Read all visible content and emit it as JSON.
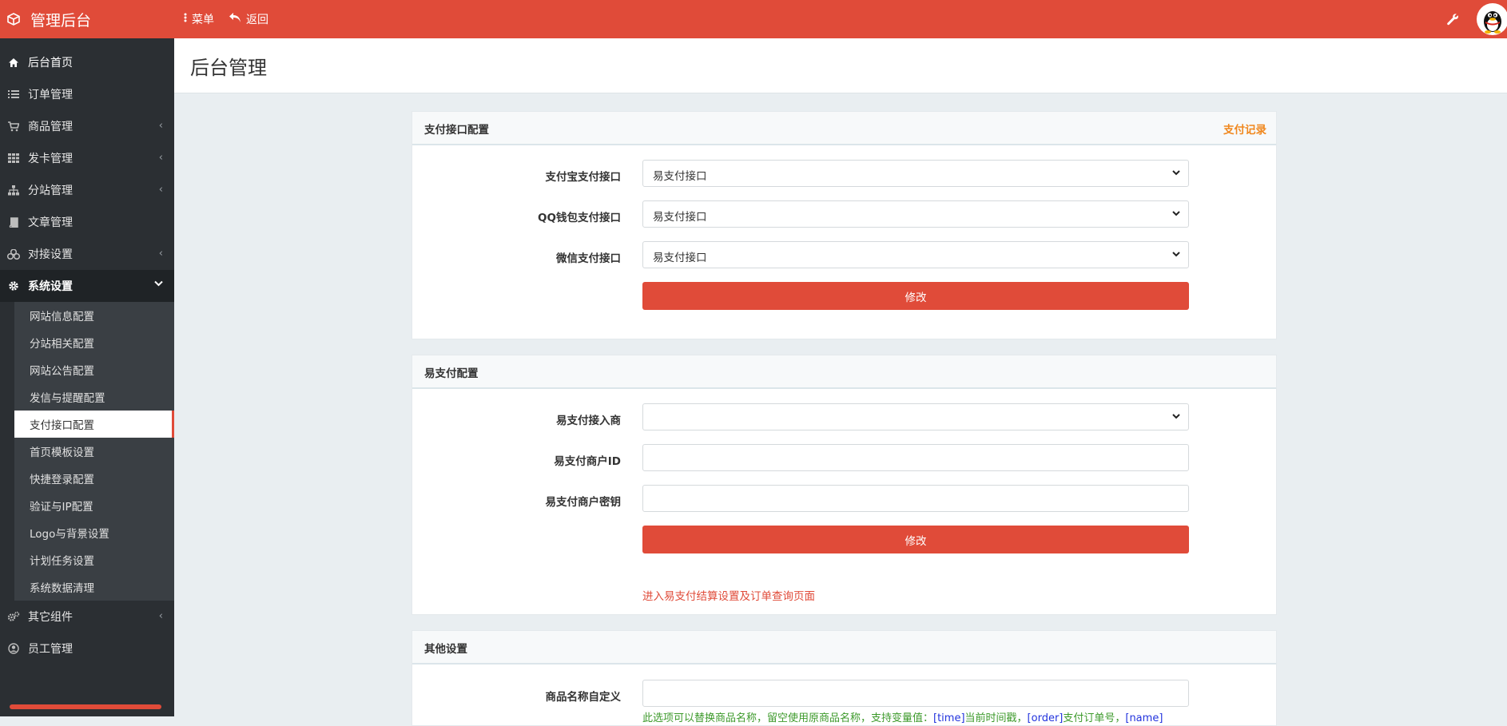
{
  "app": {
    "title": "管理后台",
    "menu_label": "菜单",
    "back_label": "返回"
  },
  "sidebar": {
    "items": [
      {
        "label": "后台首页"
      },
      {
        "label": "订单管理"
      },
      {
        "label": "商品管理"
      },
      {
        "label": "发卡管理"
      },
      {
        "label": "分站管理"
      },
      {
        "label": "文章管理"
      },
      {
        "label": "对接设置"
      },
      {
        "label": "系统设置"
      },
      {
        "label": "其它组件"
      },
      {
        "label": "员工管理"
      }
    ],
    "submenu": [
      {
        "label": "网站信息配置"
      },
      {
        "label": "分站相关配置"
      },
      {
        "label": "网站公告配置"
      },
      {
        "label": "发信与提醒配置"
      },
      {
        "label": "支付接口配置"
      },
      {
        "label": "首页模板设置"
      },
      {
        "label": "快捷登录配置"
      },
      {
        "label": "验证与IP配置"
      },
      {
        "label": "Logo与背景设置"
      },
      {
        "label": "计划任务设置"
      },
      {
        "label": "系统数据清理"
      }
    ]
  },
  "page": {
    "title": "后台管理"
  },
  "pay_panel": {
    "title": "支付接口配置",
    "link": "支付记录",
    "rows": [
      {
        "label": "支付宝支付接口",
        "value": "易支付接口"
      },
      {
        "label": "QQ钱包支付接口",
        "value": "易支付接口"
      },
      {
        "label": "微信支付接口",
        "value": "易支付接口"
      }
    ],
    "submit": "修改"
  },
  "epay_panel": {
    "title": "易支付配置",
    "rows": [
      {
        "label": "易支付接入商",
        "value": ""
      },
      {
        "label": "易支付商户ID",
        "value": ""
      },
      {
        "label": "易支付商户密钥",
        "value": ""
      }
    ],
    "submit": "修改",
    "link": "进入易支付结算设置及订单查询页面"
  },
  "other_panel": {
    "title": "其他设置",
    "rows": [
      {
        "label": "商品名称自定义",
        "value": ""
      }
    ],
    "hint_prefix": "此选项可以替换商品名称，留空使用原商品名称，支持变量值：",
    "hint_var1": "[time]",
    "hint_mid1": "当前时间戳，",
    "hint_var2": "[order]",
    "hint_mid2": "支付订单号，",
    "hint_var3": "[name]"
  },
  "colors": {
    "brand": "#e04b39",
    "sidebar": "#2b2f33",
    "link_orange": "#f0871d",
    "hint_green": "#3d9a2b"
  }
}
